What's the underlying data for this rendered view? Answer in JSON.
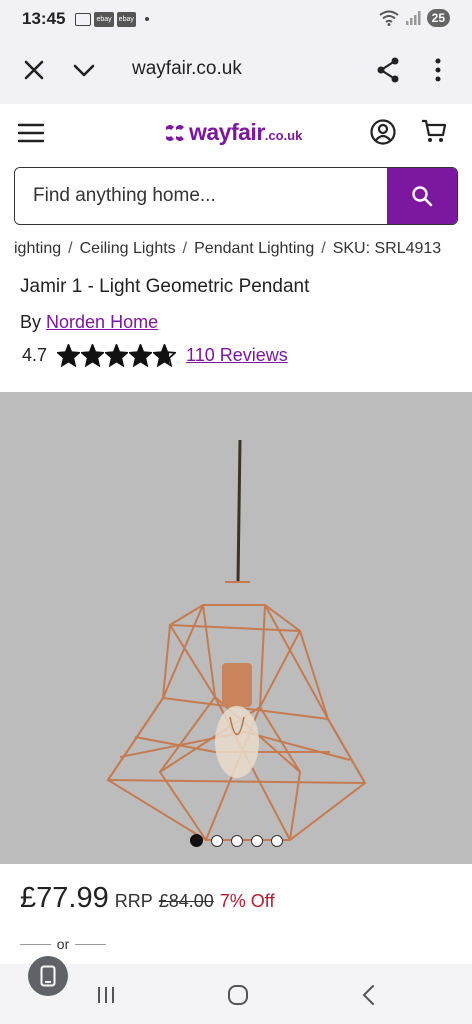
{
  "status_bar": {
    "time": "13:45",
    "badge_1": "ebay",
    "badge_2": "ebay",
    "battery": "25"
  },
  "browser": {
    "url": "wayfair.co.uk",
    "icons": [
      "close-icon",
      "chevron-down-icon",
      "share-icon",
      "more-vert-icon"
    ]
  },
  "header": {
    "logo_text": "wayfair",
    "logo_tld": ".co.uk",
    "brand_color": "#7b189f",
    "icons": [
      "menu-icon",
      "account-icon",
      "cart-icon"
    ]
  },
  "search": {
    "placeholder": "Find anything home...",
    "button_icon": "search-icon"
  },
  "breadcrumb": {
    "items": [
      "ighting",
      "Ceiling Lights",
      "Pendant Lighting",
      "SKU: SRL4913"
    ],
    "separator": "/"
  },
  "product": {
    "title": "Jamir 1 - Light Geometric Pendant",
    "by_label": "By",
    "brand": "Norden Home",
    "rating": "4.7",
    "stars": 4.7,
    "reviews": "110 Reviews",
    "image_count": 5,
    "active_image": 1
  },
  "pricing": {
    "price": "£77.99",
    "rrp_label": "RRP",
    "rrp_price": "£84.00",
    "discount": "7% Off",
    "discount_color": "#b31b34",
    "or_text": "or"
  },
  "nav_bar": {
    "icons": [
      "recent-apps-icon",
      "home-icon",
      "back-icon"
    ]
  }
}
